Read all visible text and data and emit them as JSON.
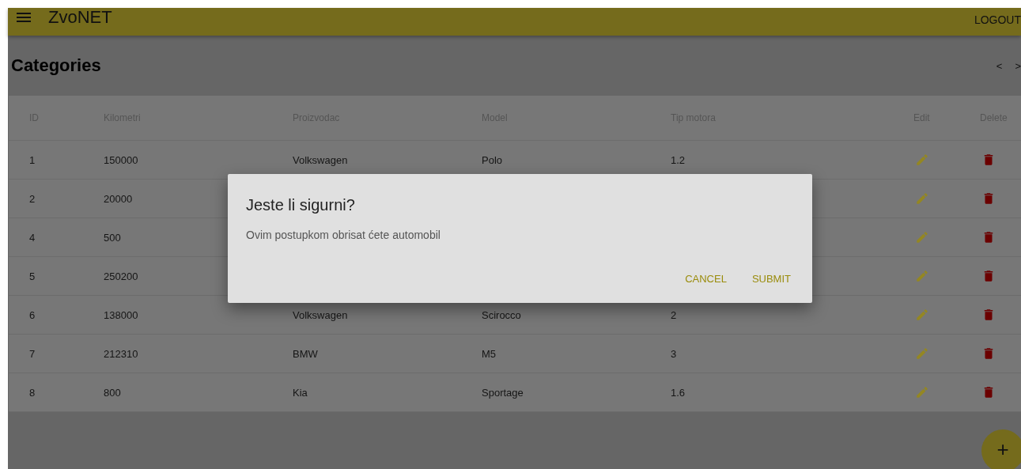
{
  "app_bar": {
    "title": "ZvoNET",
    "logout": "LOGOUT"
  },
  "page": {
    "title": "Categories",
    "prev": "<",
    "next": ">"
  },
  "table": {
    "columns": [
      "ID",
      "Kilometri",
      "Proizvodac",
      "Model",
      "Tip motora",
      "Edit",
      "Delete"
    ],
    "rows": [
      {
        "cells": [
          "1",
          "150000",
          "Volkswagen",
          "Polo",
          "1.2"
        ]
      },
      {
        "cells": [
          "2",
          "20000"
        ]
      },
      {
        "cells": [
          "4",
          "500"
        ]
      },
      {
        "cells": [
          "5",
          "250200"
        ]
      },
      {
        "cells": [
          "6",
          "138000",
          "Volkswagen",
          "Scirocco",
          "2"
        ]
      },
      {
        "cells": [
          "7",
          "212310",
          "BMW",
          "M5",
          "3"
        ]
      },
      {
        "cells": [
          "8",
          "800",
          "Kia",
          "Sportage",
          "1.6"
        ]
      }
    ]
  },
  "dialog": {
    "title": "Jeste li sigurni?",
    "message": "Ovim postupkom obrisat ćete automobil",
    "buttons": [
      "CANCEL",
      "SUBMIT"
    ]
  },
  "fab": {
    "label": "+"
  }
}
